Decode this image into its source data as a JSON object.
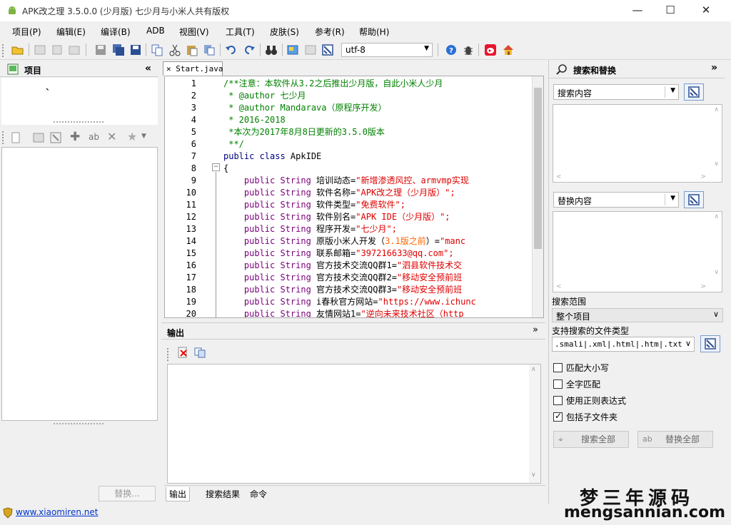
{
  "window": {
    "title": "APK改之理 3.5.0.0 (少月版)   七少月与小米人共有版权",
    "minimize": "—",
    "maximize": "☐",
    "close": "✕"
  },
  "menu": [
    "项目(P)",
    "编辑(E)",
    "编译(B)",
    "ADB",
    "视图(V)",
    "工具(T)",
    "皮肤(S)",
    "参考(R)",
    "帮助(H)"
  ],
  "toolbar": {
    "encoding": "utf-8"
  },
  "project_panel": {
    "title": "项目",
    "collapse": "«",
    "tree_mark": "、",
    "replace_button": "替换..."
  },
  "editor": {
    "tab": "Start.java",
    "lines": [
      {
        "n": "1",
        "t": [
          [
            "cm",
            "/**注意：本软件从3.2之后推出少月版，自此小米人少月"
          ]
        ]
      },
      {
        "n": "2",
        "t": [
          [
            "cm",
            " * @author 七少月"
          ]
        ]
      },
      {
        "n": "3",
        "t": [
          [
            "cm",
            " * @author Mandarava（原程序开发）"
          ]
        ]
      },
      {
        "n": "4",
        "t": [
          [
            "cm",
            " * 2016-2018"
          ]
        ]
      },
      {
        "n": "5",
        "t": [
          [
            "cm",
            " *本次为2017年8月8日更新的3.5.0版本"
          ]
        ]
      },
      {
        "n": "6",
        "t": [
          [
            "cm",
            " **/"
          ]
        ]
      },
      {
        "n": "7",
        "t": [
          [
            "kw",
            "public class "
          ],
          [
            "tx",
            "ApkIDE"
          ]
        ]
      },
      {
        "n": "8",
        "t": [
          [
            "tx",
            "{"
          ]
        ]
      },
      {
        "n": "9",
        "t": [
          [
            "mag",
            "    public String "
          ],
          [
            "tx",
            "培训动态="
          ],
          [
            "str",
            "\"新增渗透风控、armvmp实现"
          ]
        ]
      },
      {
        "n": "10",
        "t": [
          [
            "mag",
            "    public String "
          ],
          [
            "tx",
            "软件名称="
          ],
          [
            "str",
            "\"APK改之理（少月版）\";"
          ]
        ]
      },
      {
        "n": "11",
        "t": [
          [
            "mag",
            "    public String "
          ],
          [
            "tx",
            "软件类型="
          ],
          [
            "str",
            "\"免费软件\";"
          ]
        ]
      },
      {
        "n": "12",
        "t": [
          [
            "mag",
            "    public String "
          ],
          [
            "tx",
            "软件别名="
          ],
          [
            "str",
            "\"APK IDE（少月版）\";"
          ]
        ]
      },
      {
        "n": "13",
        "t": [
          [
            "mag",
            "    public String "
          ],
          [
            "tx",
            "程序开发="
          ],
          [
            "str",
            "\"七少月\";"
          ]
        ]
      },
      {
        "n": "14",
        "t": [
          [
            "mag",
            "    public String "
          ],
          [
            "tx",
            "原版小米人开发（"
          ],
          [
            "num",
            "3.1版之前"
          ],
          [
            "tx",
            "）="
          ],
          [
            "str",
            "\"manc"
          ]
        ]
      },
      {
        "n": "15",
        "t": [
          [
            "mag",
            "    public String "
          ],
          [
            "tx",
            "联系邮箱="
          ],
          [
            "str",
            "\"397216633@qq.com\";"
          ]
        ]
      },
      {
        "n": "16",
        "t": [
          [
            "mag",
            "    public String "
          ],
          [
            "tx",
            "官方技术交流QQ群1="
          ],
          [
            "str",
            "\"泗县软件技术交"
          ]
        ]
      },
      {
        "n": "17",
        "t": [
          [
            "mag",
            "    public String "
          ],
          [
            "tx",
            "官方技术交流QQ群2="
          ],
          [
            "str",
            "\"移动安全预前班"
          ]
        ]
      },
      {
        "n": "18",
        "t": [
          [
            "mag",
            "    public String "
          ],
          [
            "tx",
            "官方技术交流QQ群3="
          ],
          [
            "str",
            "\"移动安全预前班"
          ]
        ]
      },
      {
        "n": "19",
        "t": [
          [
            "mag",
            "    public String "
          ],
          [
            "tx",
            "i春秋官方网站="
          ],
          [
            "str",
            "\"https://www.ichunc"
          ]
        ]
      },
      {
        "n": "20",
        "t": [
          [
            "mag",
            "    public String "
          ],
          [
            "tx",
            "友情网站1="
          ],
          [
            "str",
            "\"逆向未来技术社区（http"
          ]
        ]
      }
    ]
  },
  "output": {
    "title": "输出",
    "collapse": "»",
    "tabs": [
      "输出",
      "搜索结果",
      "命令"
    ]
  },
  "search": {
    "title": "搜索和替换",
    "collapse": "»",
    "find_placeholder": "搜索内容",
    "replace_placeholder": "替换内容",
    "scope_label": "搜索范围",
    "scope_value": "整个项目",
    "filetypes_label": "支持搜索的文件类型",
    "filetypes_value": ".smali|.xml|.html|.htm|.txt",
    "options": [
      {
        "label": "匹配大小写",
        "checked": false
      },
      {
        "label": "全字匹配",
        "checked": false
      },
      {
        "label": "使用正则表达式",
        "checked": false
      },
      {
        "label": "包括子文件夹",
        "checked": true
      }
    ],
    "search_all": "搜索全部",
    "replace_all": "替换全部"
  },
  "status": {
    "link": "www.xiaomiren.net"
  },
  "watermark": {
    "line1": "梦三年源码",
    "line2": "mengsannian.com"
  }
}
